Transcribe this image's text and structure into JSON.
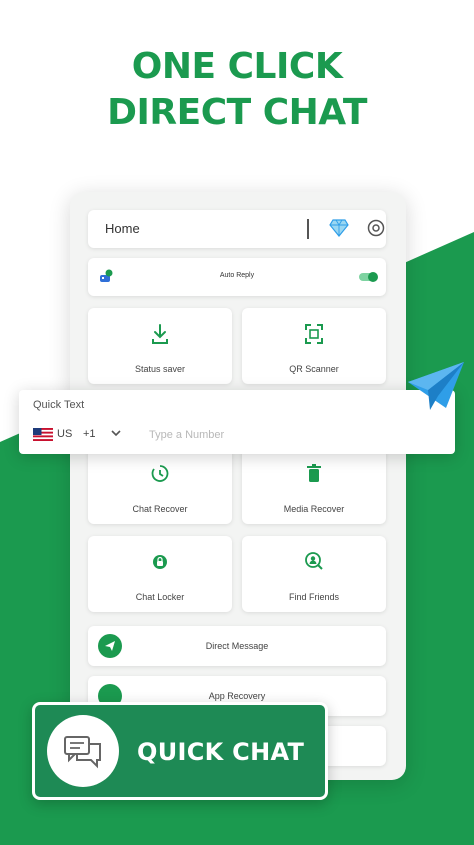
{
  "headline": {
    "line1": "ONE CLICK",
    "line2": "DIRECT CHAT"
  },
  "colors": {
    "brand": "#1b9a4f",
    "brand_dark": "#1e8a55",
    "plane": "#2f9ee8"
  },
  "home_bar": {
    "title": "Home",
    "diamond_icon": "diamond-icon",
    "settings_icon": "settings-icon"
  },
  "auto_reply": {
    "label": "Auto Reply",
    "enabled": true,
    "icon": "robot-icon"
  },
  "tiles": [
    {
      "label": "Status saver",
      "icon": "download-icon"
    },
    {
      "label": "QR Scanner",
      "icon": "qr-scan-icon"
    },
    {
      "label": "Chat Recover",
      "icon": "restore-icon"
    },
    {
      "label": "Media Recover",
      "icon": "trash-icon"
    },
    {
      "label": "Chat Locker",
      "icon": "lock-icon"
    },
    {
      "label": "Find Friends",
      "icon": "search-user-icon"
    }
  ],
  "rows": [
    {
      "label": "Direct Message",
      "icon": "send-icon"
    },
    {
      "label": "App Recovery",
      "icon": "recovery-icon"
    }
  ],
  "quick_text": {
    "title": "Quick Text",
    "country": "US",
    "dial_code": "+1",
    "placeholder": "Type a Number"
  },
  "quick_chat": {
    "label": "QUICK CHAT",
    "icon": "chat-bubbles-icon"
  }
}
